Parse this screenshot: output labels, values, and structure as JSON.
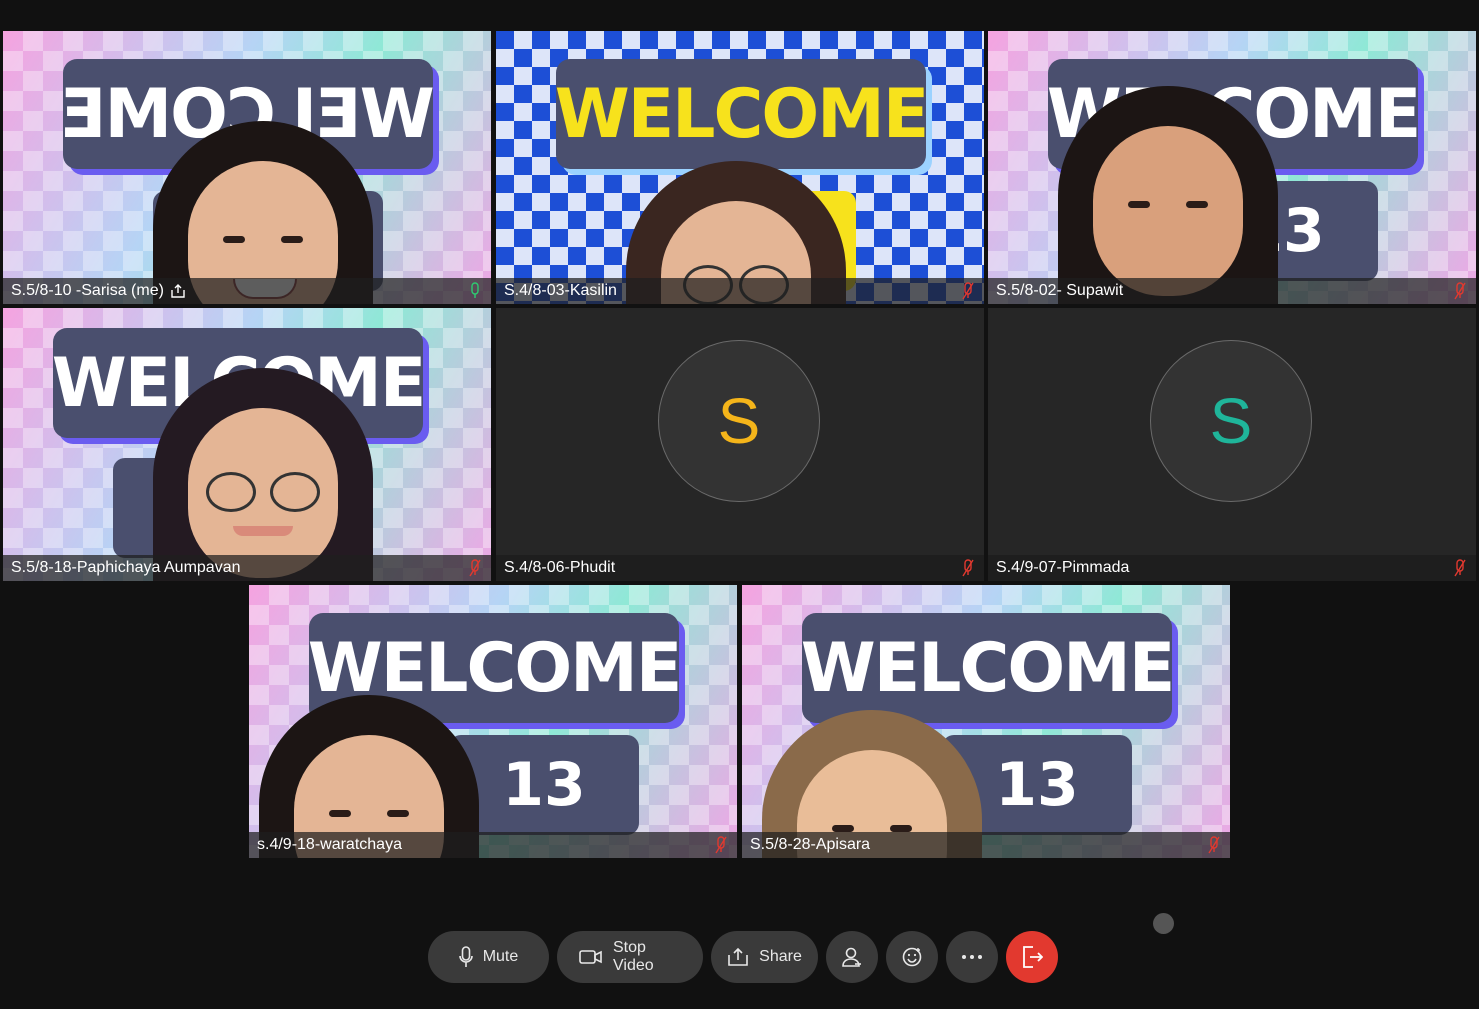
{
  "participants": [
    {
      "name": "S.5/8-10 -Sarisa (me)",
      "mic": "on",
      "self": true
    },
    {
      "name": "S.4/8-03-Kasilin",
      "mic": "muted"
    },
    {
      "name": "S.5/8-02- Supawit",
      "mic": "muted"
    },
    {
      "name": "S.5/8-18-Paphichaya Aumpavan",
      "mic": "muted"
    },
    {
      "name": "S.4/8-06-Phudit",
      "mic": "muted",
      "avatar_initial": "S",
      "avatar_color": "#f5b51a"
    },
    {
      "name": "S.4/9-07-Pimmada",
      "mic": "muted",
      "avatar_initial": "S",
      "avatar_color": "#1fb59a"
    },
    {
      "name": "s.4/9-18-waratchaya",
      "mic": "muted"
    },
    {
      "name": "S.5/8-28-Apisara",
      "mic": "muted"
    }
  ],
  "background": {
    "banner_word": "WELCOME",
    "number": "13"
  },
  "toolbar": {
    "mute_label": "Mute",
    "stop_video_label": "Stop Video",
    "share_label": "Share"
  },
  "colors": {
    "muted_mic": "#e2392f",
    "active_mic": "#2ecc71",
    "leave": "#e2392f",
    "active_border": "#2a6fd6"
  }
}
